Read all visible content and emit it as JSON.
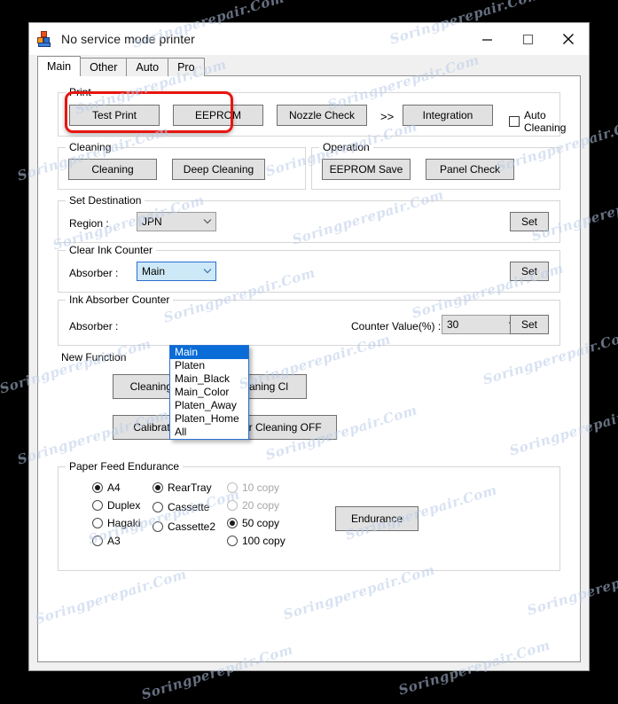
{
  "window": {
    "title": "No service mode printer",
    "icon": "printer-app-icon",
    "minimize": "—",
    "maximize": "□",
    "close": "✕"
  },
  "tabs": [
    {
      "label": "Main",
      "active": true
    },
    {
      "label": "Other",
      "active": false
    },
    {
      "label": "Auto",
      "active": false
    },
    {
      "label": "Pro",
      "active": false
    }
  ],
  "print_group": {
    "title": "Print",
    "test_print": "Test Print",
    "eeprom": "EEPROM",
    "nozzle_check": "Nozzle Check",
    "chevron": ">>",
    "integration": "Integration",
    "auto_cleaning": "Auto Cleaning",
    "auto_cleaning_checked": false
  },
  "cleaning_group": {
    "title": "Cleaning",
    "cleaning": "Cleaning",
    "deep_cleaning": "Deep Cleaning"
  },
  "operation_group": {
    "title": "Operation",
    "eeprom_save": "EEPROM Save",
    "panel_check": "Panel Check"
  },
  "set_destination_group": {
    "title": "Set Destination",
    "region_label": "Region :",
    "region_value": "JPN",
    "set_button": "Set"
  },
  "clear_ink_counter_group": {
    "title": "Clear Ink Counter",
    "absorber_label": "Absorber :",
    "absorber_value": "Main",
    "set_button": "Set",
    "dropdown_open": true,
    "dropdown_options": [
      "Main",
      "Platen",
      "Main_Black",
      "Main_Color",
      "Platen_Away",
      "Platen_Home",
      "All"
    ],
    "dropdown_selected_index": 0
  },
  "ink_absorber_counter_group": {
    "title": "Ink Absorber Counter",
    "absorber_label": "Absorber :",
    "counter_value_label": "Counter Value(%) :",
    "counter_value": "30",
    "set_button": "Set"
  },
  "new_function_group": {
    "title": "New Function",
    "cleaning_bk": "Cleaning Bk",
    "cleaning_cl": "Cleaning Cl",
    "calibration": "Calibration",
    "user_cleaning_off": "User Cleaning OFF"
  },
  "paper_feed_group": {
    "title": "Paper Feed Endurance",
    "paper_options": [
      {
        "label": "A4",
        "checked": true,
        "disabled": false
      },
      {
        "label": "Duplex",
        "checked": false,
        "disabled": false
      },
      {
        "label": "Hagaki",
        "checked": false,
        "disabled": false
      },
      {
        "label": "A3",
        "checked": false,
        "disabled": false
      }
    ],
    "source_options": [
      {
        "label": "RearTray",
        "checked": true,
        "disabled": false
      },
      {
        "label": "Cassette",
        "checked": false,
        "disabled": false
      },
      {
        "label": "Cassette2",
        "checked": false,
        "disabled": false
      }
    ],
    "copy_options": [
      {
        "label": "10 copy",
        "checked": false,
        "disabled": true
      },
      {
        "label": "20 copy",
        "checked": false,
        "disabled": true
      },
      {
        "label": "50 copy",
        "checked": true,
        "disabled": false
      },
      {
        "label": "100 copy",
        "checked": false,
        "disabled": false
      }
    ],
    "endurance_button": "Endurance"
  },
  "watermark": {
    "text": "Soringperepair.Com",
    "color": "#b9cbe8"
  },
  "colors": {
    "accent": "#0a6cd6",
    "annotation": "#e8150f",
    "window_bg": "#f0f0f0",
    "button_face": "#e1e1e1"
  }
}
